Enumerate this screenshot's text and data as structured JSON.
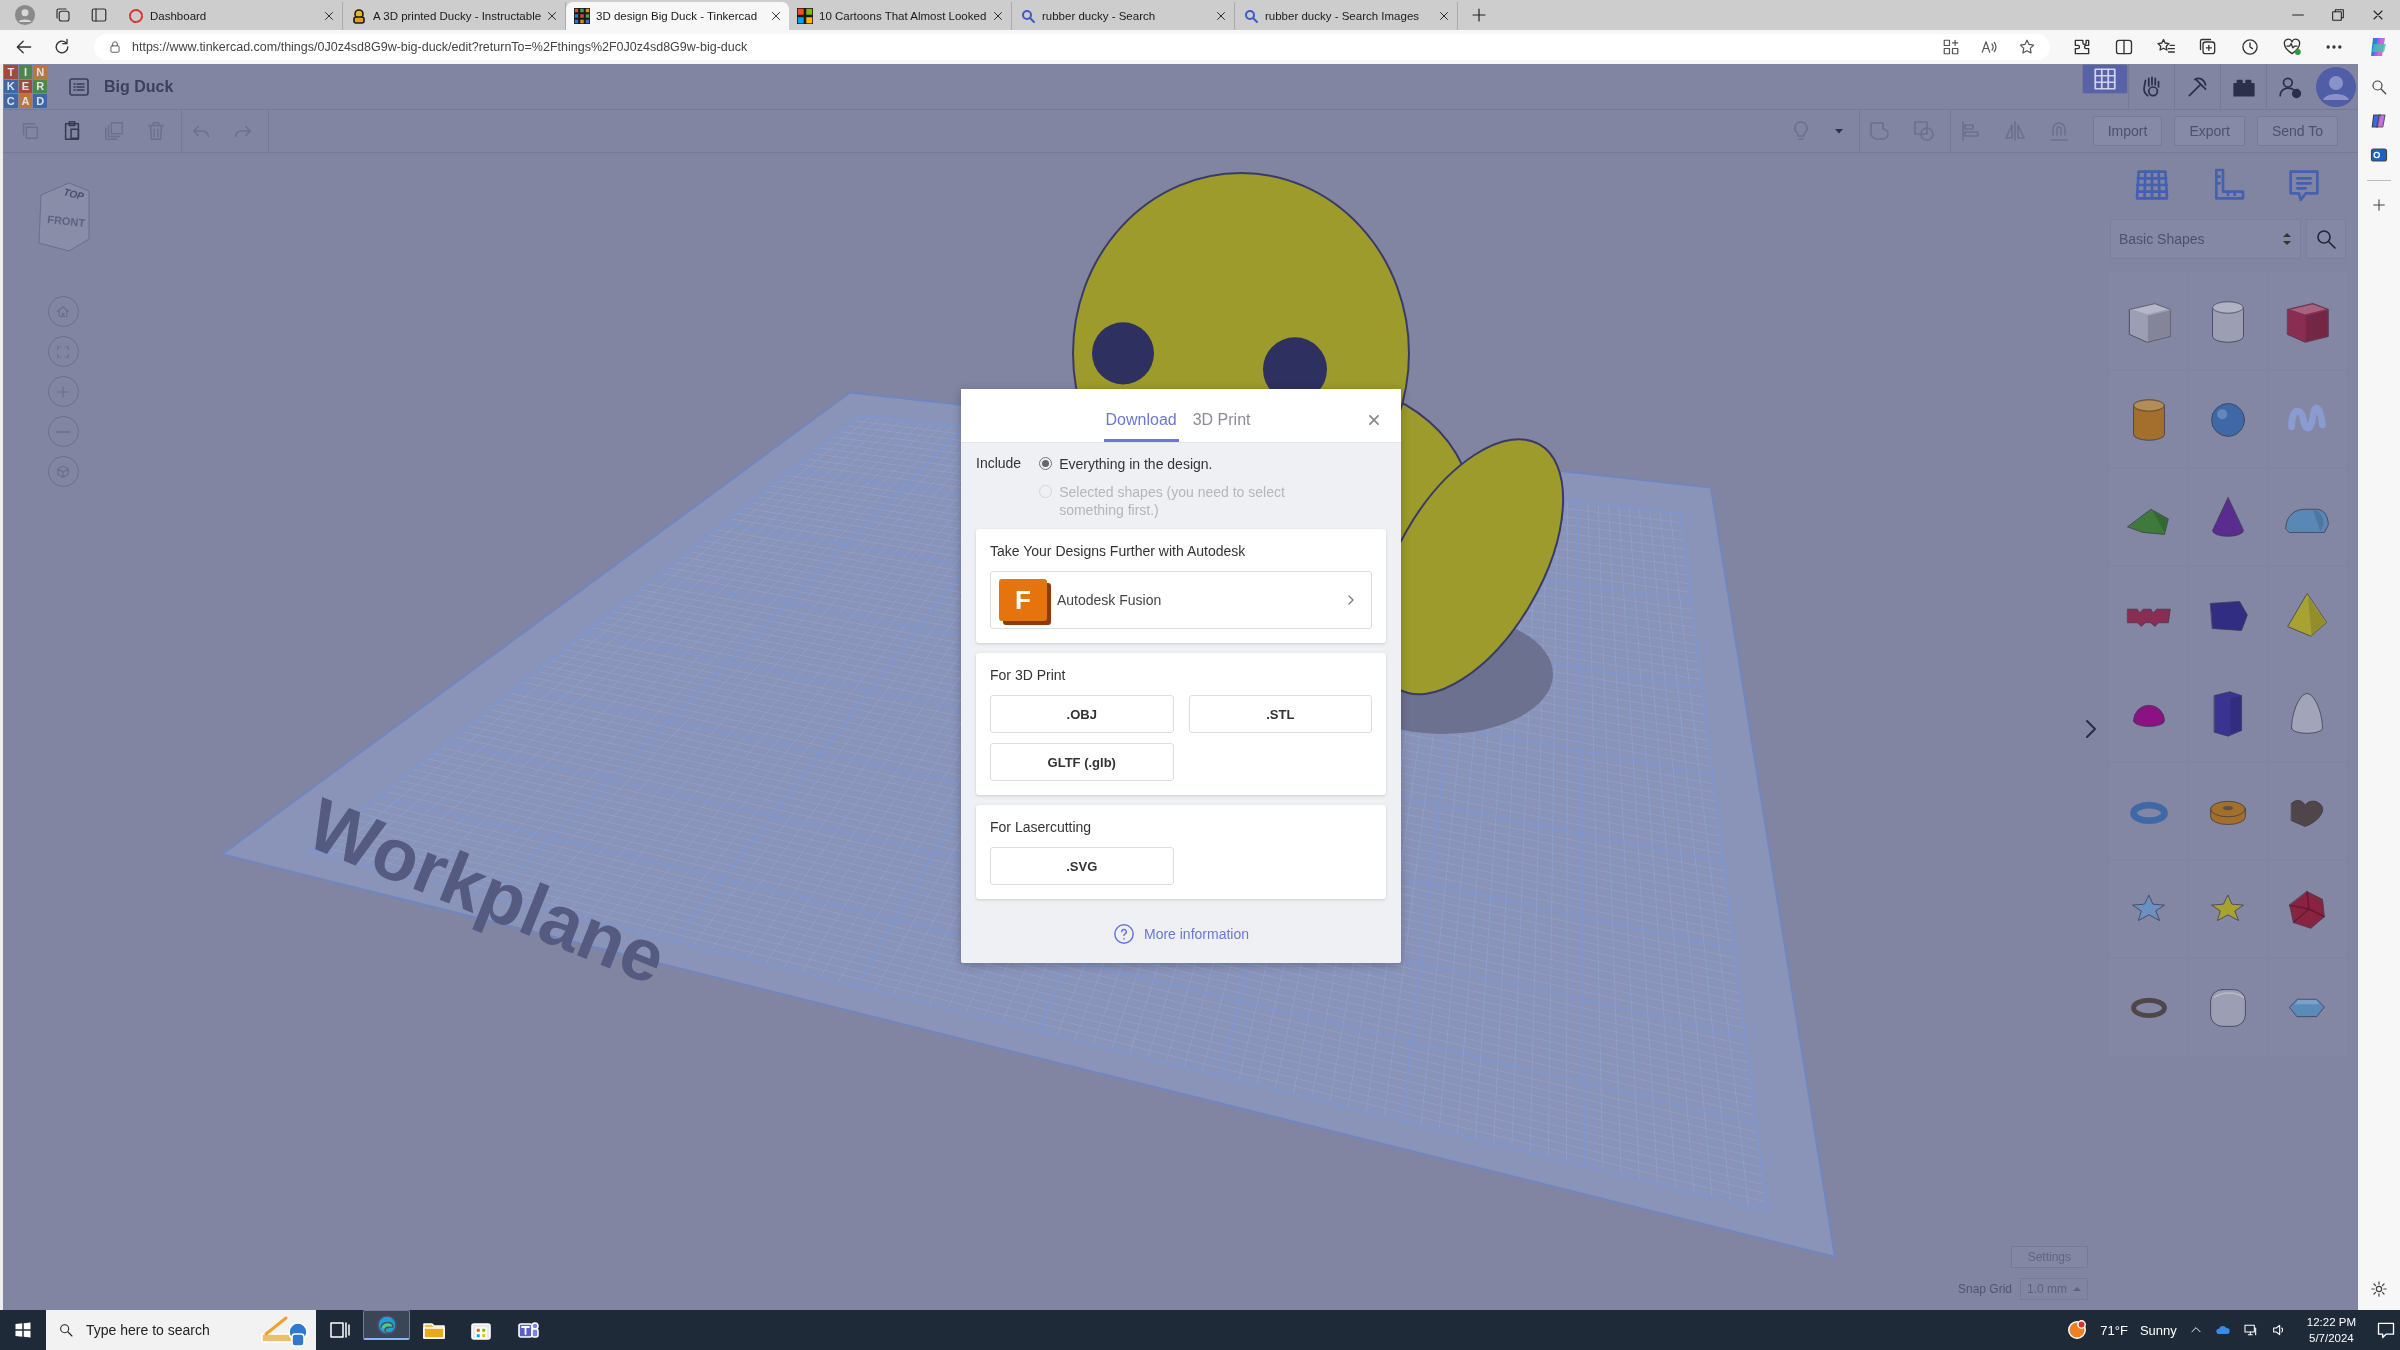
{
  "browser": {
    "tabs": [
      {
        "title": "Dashboard",
        "kind": "ring",
        "selected": false
      },
      {
        "title": "A 3D printed Ducky - Instructable",
        "kind": "figure",
        "selected": false
      },
      {
        "title": "3D design Big Duck - Tinkercad",
        "kind": "tiles",
        "selected": true
      },
      {
        "title": "10 Cartoons That Almost Looked",
        "kind": "squares",
        "selected": false
      },
      {
        "title": "rubber ducky - Search",
        "kind": "search",
        "selected": false
      },
      {
        "title": "rubber ducky - Search Images",
        "kind": "search",
        "selected": false
      }
    ],
    "address": "https://www.tinkercad.com/things/0J0z4sd8G9w-big-duck/edit?returnTo=%2Fthings%2F0J0z4sd8G9w-big-duck"
  },
  "app": {
    "logo": [
      "T",
      "I",
      "N",
      "K",
      "E",
      "R",
      "C",
      "A",
      "D"
    ],
    "title": "Big Duck",
    "actions": [
      "Import",
      "Export",
      "Send To"
    ],
    "view_cube": {
      "top": "TOP",
      "front": "FRONT"
    },
    "workplane_label": "Workplane",
    "shape_library": "Basic Shapes",
    "shapes": [
      {
        "kind": "box",
        "color": "#9c9eb4"
      },
      {
        "kind": "cylinder",
        "color": "#9c9eb4"
      },
      {
        "kind": "box",
        "color": "#8a2d52"
      },
      {
        "kind": "cylinder",
        "color": "#a26f2c"
      },
      {
        "kind": "sphere",
        "color": "#3e69a6"
      },
      {
        "kind": "squiggle",
        "color": "#8a9bd2"
      },
      {
        "kind": "wedge",
        "color": "#3f7a3c"
      },
      {
        "kind": "cone",
        "color": "#5b2c8f"
      },
      {
        "kind": "half-cylinder",
        "color": "#5a88b6"
      },
      {
        "kind": "blocky",
        "color": "#8a2d52"
      },
      {
        "kind": "pentagon",
        "color": "#302d82"
      },
      {
        "kind": "pyramid",
        "color": "#a8a232"
      },
      {
        "kind": "dome",
        "color": "#8a1282"
      },
      {
        "kind": "prism",
        "color": "#3b3392"
      },
      {
        "kind": "paraboloid",
        "color": "#a2a4ba"
      },
      {
        "kind": "torus",
        "color": "#3e69a6"
      },
      {
        "kind": "tube",
        "color": "#a26f2c"
      },
      {
        "kind": "heart",
        "color": "#504649"
      },
      {
        "kind": "star",
        "color": "#6b90c2"
      },
      {
        "kind": "star",
        "color": "#a8a232"
      },
      {
        "kind": "polyhedron",
        "color": "#8a2242"
      },
      {
        "kind": "ring",
        "color": "#504649"
      },
      {
        "kind": "rounded-box",
        "color": "#9c9eb4"
      },
      {
        "kind": "gem",
        "color": "#5a8ab8"
      }
    ],
    "settings_button": "Settings",
    "snap_grid": {
      "label": "Snap Grid",
      "value": "1.0 mm"
    }
  },
  "dialog": {
    "tabs": [
      {
        "label": "Download",
        "selected": true
      },
      {
        "label": "3D Print",
        "selected": false
      }
    ],
    "include_label": "Include",
    "options": [
      {
        "label": "Everything in the design.",
        "selected": true,
        "disabled": false
      },
      {
        "label": "Selected shapes (you need to select something first.)",
        "selected": false,
        "disabled": true
      }
    ],
    "sections": [
      {
        "kind": "promo",
        "title": "Take Your Designs Further with Autodesk",
        "logo": "F",
        "link": "Autodesk Fusion"
      },
      {
        "kind": "formats",
        "title": "For 3D Print",
        "buttons": [
          ".OBJ",
          ".STL",
          "GLTF (.glb)"
        ]
      },
      {
        "kind": "formats",
        "title": "For Lasercutting",
        "buttons": [
          ".SVG"
        ]
      }
    ],
    "help_link": "More information"
  },
  "taskbar": {
    "search": {
      "placeholder": "Type here to search"
    },
    "weather": {
      "temperature": "71°F",
      "condition": "Sunny"
    },
    "time": "12:22 PM",
    "date": "5/7/2024"
  }
}
